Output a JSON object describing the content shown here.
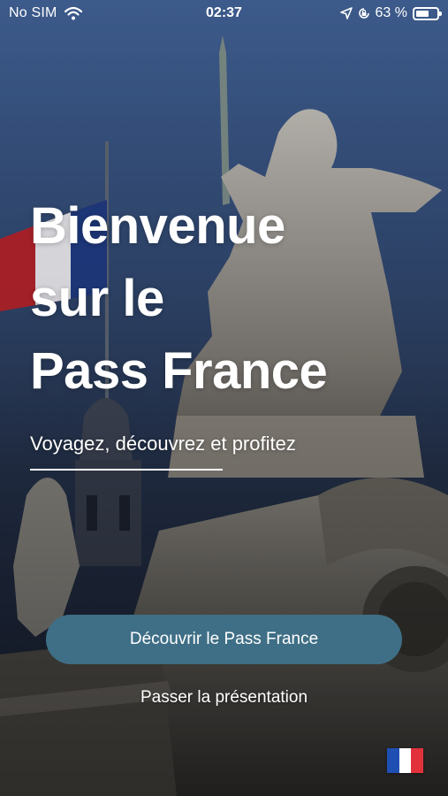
{
  "status_bar": {
    "carrier": "No SIM",
    "time": "02:37",
    "battery_percent": "63 %",
    "battery_level": 0.63,
    "icons": [
      "wifi-icon",
      "location-icon",
      "lock-rotation-icon",
      "battery-icon"
    ]
  },
  "hero": {
    "title_lines": [
      "Bienvenue",
      "sur le",
      "Pass France"
    ],
    "subtitle": "Voyagez, découvrez et profitez"
  },
  "actions": {
    "primary_label": "Découvrir le Pass France",
    "skip_label": "Passer la présentation"
  },
  "language": {
    "icon": "france-flag-icon",
    "colors": [
      "#1f4fb3",
      "#ffffff",
      "#e1323c"
    ]
  },
  "colors": {
    "primary_button": "#3f6f86",
    "text": "#ffffff"
  }
}
